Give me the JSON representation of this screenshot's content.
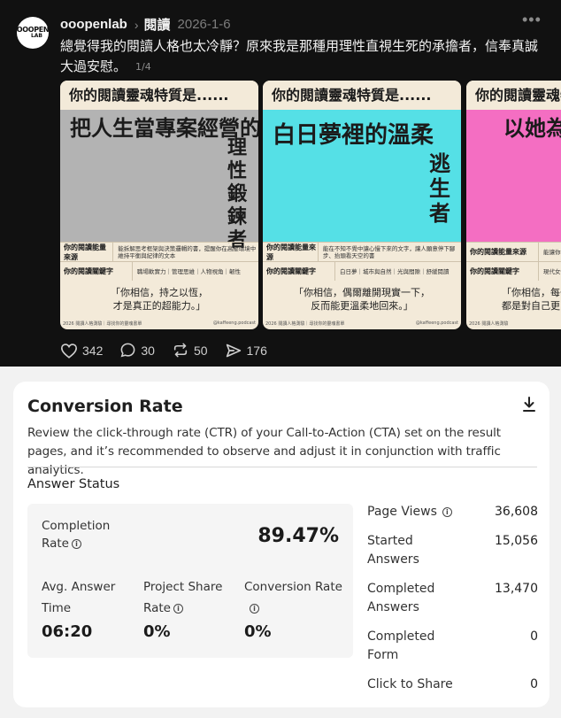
{
  "post": {
    "avatar_text_top": "OOOPEN",
    "avatar_text_bottom": "LAB",
    "username": "ooopenlab",
    "topic": "閱讀",
    "date": "2026-1-6",
    "text": "總覺得我的閱讀人格也太冷靜？原來我是那種用理性直視生死的承擔者，信奉真誠大過安慰。",
    "pager": "1/4",
    "cards": [
      {
        "header": "你的閱讀靈魂特質是......",
        "big_line": "把人生當專案經營的",
        "vertical": "理性鍛鍊者",
        "band_color": "#b3b3b3",
        "row1_key": "你的閱讀能量來源",
        "row1_val": "能拆解思考框架與決策邏輯的書，提醒你在高壓環境中維持平衡與紀律的文本",
        "row2_key": "你的閱讀關鍵字",
        "row2_val": "職場軟實力｜管理思維｜人物視角｜韌性",
        "quote": "「你相信，持之以恆，\n才是真正的超能力。」",
        "foot_left": "2026 閱讀人格測驗｜尋找你的靈魂書單",
        "foot_right": "@kaffeeng.podcast"
      },
      {
        "header": "你的閱讀靈魂特質是......",
        "big_line": "白日夢裡的溫柔",
        "vertical": "逃生者",
        "band_color": "#55e0e6",
        "row1_key": "你的閱讀能量來源",
        "row1_val": "能在不知不覺中讓心慢下來的文字，讓人願意停下腳步、抬頭看天空的書",
        "row2_key": "你的閱讀關鍵字",
        "row2_val": "白日夢｜城市與自然｜光與間隙｜舒緩閱讀",
        "quote": "「你相信，偶爾離開現實一下，\n反而能更溫柔地回來。」",
        "foot_left": "2026 閱讀人格測驗｜尋找你的靈魂書單",
        "foot_right": "@kaffeeng.podcast"
      },
      {
        "header": "你的閱讀靈魂特質是......",
        "big_line": "以她為",
        "vertical": "",
        "band_color": "#f46ec2",
        "row1_key": "你的閱讀能量來源",
        "row1_val": "能讓你把人生",
        "row2_key": "你的閱讀關鍵字",
        "row2_val": "現代女性",
        "quote": "「你相信，每一\n都是對自己更",
        "foot_left": "2026 閱讀人格測驗",
        "foot_right": ""
      }
    ],
    "actions": {
      "likes": "342",
      "comments": "30",
      "reposts": "50",
      "shares": "176"
    }
  },
  "panel": {
    "title": "Conversion Rate",
    "description": "Review the click-through rate (CTR) of your Call-to-Action (CTA) set on the result pages, and it’s recommended to observe and adjust it in conjunction with traffic analytics.",
    "answer_status_title": "Answer Status",
    "completion_rate_label_1": "Completion",
    "completion_rate_label_2": "Rate",
    "completion_rate_value": "89.47%",
    "avg_answer_label_1": "Avg. Answer",
    "avg_answer_label_2": "Time",
    "avg_answer_value": "06:20",
    "project_share_label_1": "Project Share",
    "project_share_label_2": "Rate",
    "project_share_value": "0%",
    "conversion_label": "Conversion Rate",
    "conversion_value": "0%",
    "side_stats": [
      {
        "label": "Page Views",
        "value": "36,608"
      },
      {
        "label": "Started Answers",
        "value": "15,056"
      },
      {
        "label": "Completed Answers",
        "value": "13,470"
      },
      {
        "label": "Completed Form",
        "value": "0"
      },
      {
        "label": "Click to Share",
        "value": "0"
      }
    ],
    "info_glyph": "i"
  }
}
